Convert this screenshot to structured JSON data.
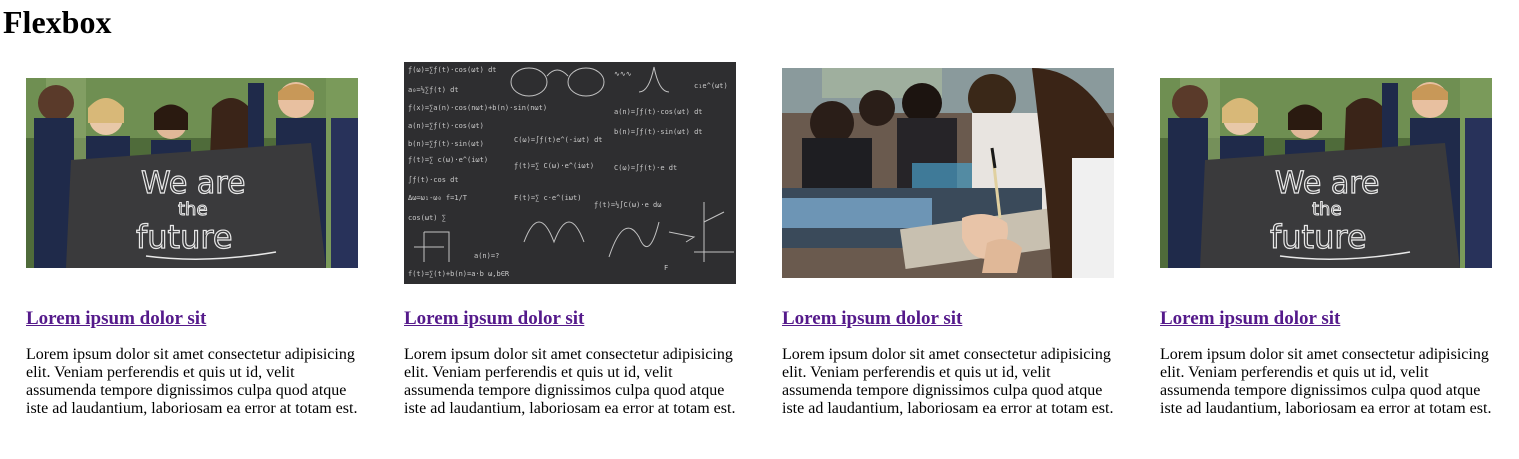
{
  "page": {
    "title": "Flexbox"
  },
  "cards": [
    {
      "image": "students-holding-we-are-the-future-chalkboard",
      "image_text": [
        "We are",
        "the",
        "future"
      ],
      "link": "Lorem ipsum dolor sit",
      "text": "Lorem ipsum dolor sit amet consectetur adipisicing elit. Veniam perferendis et quis ut id, velit assumenda tempore dignissimos culpa quod atque iste ad laudantium, laboriosam ea error at totam est."
    },
    {
      "image": "chalkboard-with-math-formulas",
      "link": "Lorem ipsum dolor sit",
      "text": "Lorem ipsum dolor sit amet consectetur adipisicing elit. Veniam perferendis et quis ut id, velit assumenda tempore dignissimos culpa quod atque iste ad laudantium, laboriosam ea error at totam est."
    },
    {
      "image": "student-writing-in-classroom",
      "link": "Lorem ipsum dolor sit",
      "text": "Lorem ipsum dolor sit amet consectetur adipisicing elit. Veniam perferendis et quis ut id, velit assumenda tempore dignissimos culpa quod atque iste ad laudantium, laboriosam ea error at totam est."
    },
    {
      "image": "students-holding-we-are-the-future-chalkboard",
      "image_text": [
        "We are",
        "the",
        "future"
      ],
      "link": "Lorem ipsum dolor sit",
      "text": "Lorem ipsum dolor sit amet consectetur adipisicing elit. Veniam perferendis et quis ut id, velit assumenda tempore dignissimos culpa quod atque iste ad laudantium, laboriosam ea error at totam est."
    }
  ],
  "colors": {
    "link_visited": "#551a8b",
    "text": "#000000",
    "chalkboard": "#3a3a3c",
    "chalk": "#e8e8e8"
  }
}
